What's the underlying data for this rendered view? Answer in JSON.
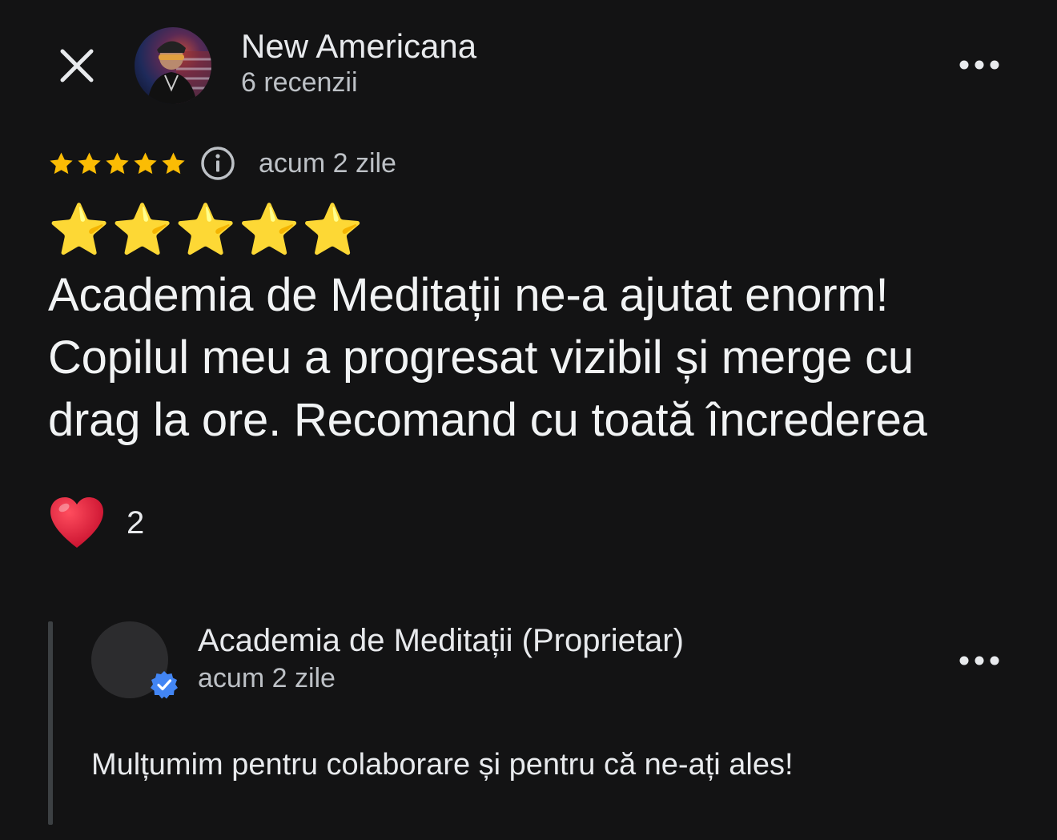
{
  "header": {
    "author_name": "New Americana",
    "review_count": "6 recenzii",
    "close_icon": "close-icon",
    "more_icon": "more-horizontal-icon"
  },
  "review": {
    "rating": 5,
    "rating_max": 5,
    "star_color": "#fbbc04",
    "time": "acum 2 zile",
    "emoji_stars": "⭐⭐⭐⭐⭐",
    "text": "Academia de Meditații ne-a ajutat enorm! Copilul meu a progresat vizibil și merge cu drag la ore. Recomand cu toată încrederea",
    "reaction_icon": "heart-icon",
    "reaction_count": "2"
  },
  "owner_reply": {
    "name": "Academia de Meditații (Proprietar)",
    "time": "acum 2 zile",
    "text": "Mulțumim pentru colaborare și pentru că ne-ați ales!",
    "badge_icon": "verified-check-icon",
    "badge_color": "#4285f4"
  }
}
